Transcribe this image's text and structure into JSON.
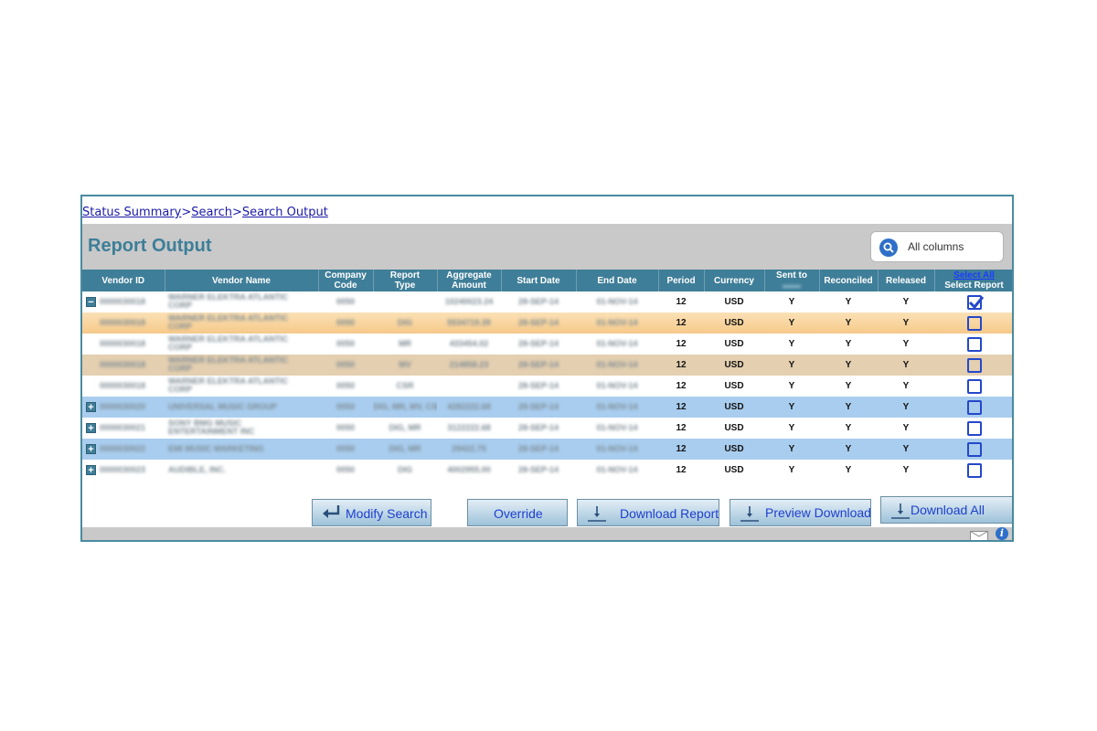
{
  "breadcrumb": [
    {
      "label": "Status Summary"
    },
    {
      "label": "Search"
    },
    {
      "label": "Search Output"
    }
  ],
  "breadcrumb_separator": ">",
  "title": "Report Output",
  "search": {
    "label": "All columns"
  },
  "columns": {
    "vendor_id": "Vendor ID",
    "vendor_name": "Vendor Name",
    "company_code_1": "Company",
    "company_code_2": "Code",
    "report_type_1": "Report",
    "report_type_2": "Type",
    "aggregate_1": "Aggregate",
    "aggregate_2": "Amount",
    "start_date": "Start Date",
    "end_date": "End Date",
    "period": "Period",
    "currency": "Currency",
    "sent_to": "Sent to",
    "reconciled": "Reconciled",
    "released": "Released",
    "select_all": "Select All",
    "select_report": "Select Report"
  },
  "rows": [
    {
      "toggle": "−",
      "vendor_id": "0000030018",
      "vendor_name": "WARNER ELEKTRA ATLANTIC CORP",
      "company": "0050",
      "type": "",
      "amount": "10240023.24",
      "start": "28-SEP-14",
      "end": "01-NOV-14",
      "period": "12",
      "currency": "USD",
      "sent": "Y",
      "reconciled": "Y",
      "released": "Y",
      "checked": true,
      "style": "white"
    },
    {
      "toggle": "",
      "vendor_id": "0000030018",
      "vendor_name": "WARNER ELEKTRA ATLANTIC CORP",
      "company": "0050",
      "type": "DIG",
      "amount": "5534719.39",
      "start": "28-SEP-14",
      "end": "01-NOV-14",
      "period": "12",
      "currency": "USD",
      "sent": "Y",
      "reconciled": "Y",
      "released": "Y",
      "checked": false,
      "style": "orange"
    },
    {
      "toggle": "",
      "vendor_id": "0000030018",
      "vendor_name": "WARNER ELEKTRA ATLANTIC CORP",
      "company": "0050",
      "type": "MR",
      "amount": "433454.02",
      "start": "28-SEP-14",
      "end": "01-NOV-14",
      "period": "12",
      "currency": "USD",
      "sent": "Y",
      "reconciled": "Y",
      "released": "Y",
      "checked": false,
      "style": "white"
    },
    {
      "toggle": "",
      "vendor_id": "0000030018",
      "vendor_name": "WARNER ELEKTRA ATLANTIC CORP",
      "company": "0050",
      "type": "MV",
      "amount": "214858.23",
      "start": "28-SEP-14",
      "end": "01-NOV-14",
      "period": "12",
      "currency": "USD",
      "sent": "Y",
      "reconciled": "Y",
      "released": "Y",
      "checked": false,
      "style": "tan"
    },
    {
      "toggle": "",
      "vendor_id": "0000030018",
      "vendor_name": "WARNER ELEKTRA ATLANTIC CORP",
      "company": "0050",
      "type": "CSR",
      "amount": "",
      "start": "28-SEP-14",
      "end": "01-NOV-14",
      "period": "12",
      "currency": "USD",
      "sent": "Y",
      "reconciled": "Y",
      "released": "Y",
      "checked": false,
      "style": "white"
    },
    {
      "toggle": "+",
      "vendor_id": "0000030020",
      "vendor_name": "UNIVERSAL MUSIC GROUP",
      "company": "0050",
      "type": "DIG, MR, MV, CSR",
      "amount": "4282222.68",
      "start": "28-SEP-14",
      "end": "01-NOV-14",
      "period": "12",
      "currency": "USD",
      "sent": "Y",
      "reconciled": "Y",
      "released": "Y",
      "checked": false,
      "style": "blue"
    },
    {
      "toggle": "+",
      "vendor_id": "0000030021",
      "vendor_name": "SONY BMG MUSIC ENTERTAINMENT INC",
      "company": "0050",
      "type": "DIG, MR",
      "amount": "3122222.68",
      "start": "28-SEP-14",
      "end": "01-NOV-14",
      "period": "12",
      "currency": "USD",
      "sent": "Y",
      "reconciled": "Y",
      "released": "Y",
      "checked": false,
      "style": "white"
    },
    {
      "toggle": "+",
      "vendor_id": "0000030022",
      "vendor_name": "EMI MUSIC MARKETING",
      "company": "0050",
      "type": "DIG, MR",
      "amount": "29422.75",
      "start": "28-SEP-14",
      "end": "01-NOV-14",
      "period": "12",
      "currency": "USD",
      "sent": "Y",
      "reconciled": "Y",
      "released": "Y",
      "checked": false,
      "style": "blue"
    },
    {
      "toggle": "+",
      "vendor_id": "0000030023",
      "vendor_name": "AUDIBLE, INC.",
      "company": "0050",
      "type": "DIG",
      "amount": "4002955.00",
      "start": "28-SEP-14",
      "end": "01-NOV-14",
      "period": "12",
      "currency": "USD",
      "sent": "Y",
      "reconciled": "Y",
      "released": "Y",
      "checked": false,
      "style": "white"
    }
  ],
  "buttons": {
    "modify_search": "Modify Search",
    "override": "Override",
    "download_report": "Download Report",
    "preview_download": "Preview Download",
    "download_all": "Download All"
  },
  "icons": {
    "search": "search-icon",
    "mail": "mail-icon",
    "info": "info-icon",
    "checked": "checkmark-icon"
  },
  "colors": {
    "header_bg": "#3f7e98",
    "title_text": "#3d7e98",
    "link": "#1a1aa6",
    "row_blue": "#a9cdee",
    "row_orange": "#f6c98a",
    "row_tan": "#e4cfb0",
    "checkbox": "#2448c9"
  }
}
